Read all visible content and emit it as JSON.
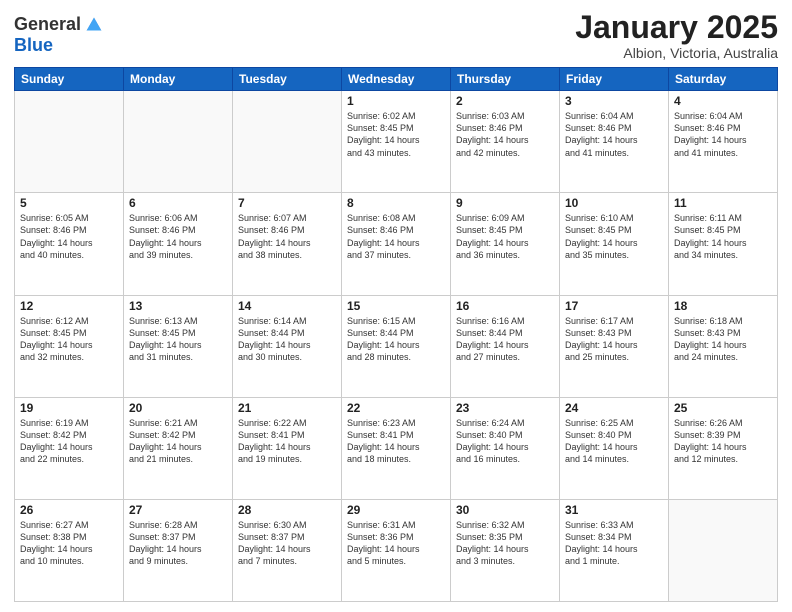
{
  "logo": {
    "general": "General",
    "blue": "Blue"
  },
  "header": {
    "month": "January 2025",
    "location": "Albion, Victoria, Australia"
  },
  "weekdays": [
    "Sunday",
    "Monday",
    "Tuesday",
    "Wednesday",
    "Thursday",
    "Friday",
    "Saturday"
  ],
  "weeks": [
    [
      {
        "day": "",
        "info": ""
      },
      {
        "day": "",
        "info": ""
      },
      {
        "day": "",
        "info": ""
      },
      {
        "day": "1",
        "info": "Sunrise: 6:02 AM\nSunset: 8:45 PM\nDaylight: 14 hours\nand 43 minutes."
      },
      {
        "day": "2",
        "info": "Sunrise: 6:03 AM\nSunset: 8:46 PM\nDaylight: 14 hours\nand 42 minutes."
      },
      {
        "day": "3",
        "info": "Sunrise: 6:04 AM\nSunset: 8:46 PM\nDaylight: 14 hours\nand 41 minutes."
      },
      {
        "day": "4",
        "info": "Sunrise: 6:04 AM\nSunset: 8:46 PM\nDaylight: 14 hours\nand 41 minutes."
      }
    ],
    [
      {
        "day": "5",
        "info": "Sunrise: 6:05 AM\nSunset: 8:46 PM\nDaylight: 14 hours\nand 40 minutes."
      },
      {
        "day": "6",
        "info": "Sunrise: 6:06 AM\nSunset: 8:46 PM\nDaylight: 14 hours\nand 39 minutes."
      },
      {
        "day": "7",
        "info": "Sunrise: 6:07 AM\nSunset: 8:46 PM\nDaylight: 14 hours\nand 38 minutes."
      },
      {
        "day": "8",
        "info": "Sunrise: 6:08 AM\nSunset: 8:46 PM\nDaylight: 14 hours\nand 37 minutes."
      },
      {
        "day": "9",
        "info": "Sunrise: 6:09 AM\nSunset: 8:45 PM\nDaylight: 14 hours\nand 36 minutes."
      },
      {
        "day": "10",
        "info": "Sunrise: 6:10 AM\nSunset: 8:45 PM\nDaylight: 14 hours\nand 35 minutes."
      },
      {
        "day": "11",
        "info": "Sunrise: 6:11 AM\nSunset: 8:45 PM\nDaylight: 14 hours\nand 34 minutes."
      }
    ],
    [
      {
        "day": "12",
        "info": "Sunrise: 6:12 AM\nSunset: 8:45 PM\nDaylight: 14 hours\nand 32 minutes."
      },
      {
        "day": "13",
        "info": "Sunrise: 6:13 AM\nSunset: 8:45 PM\nDaylight: 14 hours\nand 31 minutes."
      },
      {
        "day": "14",
        "info": "Sunrise: 6:14 AM\nSunset: 8:44 PM\nDaylight: 14 hours\nand 30 minutes."
      },
      {
        "day": "15",
        "info": "Sunrise: 6:15 AM\nSunset: 8:44 PM\nDaylight: 14 hours\nand 28 minutes."
      },
      {
        "day": "16",
        "info": "Sunrise: 6:16 AM\nSunset: 8:44 PM\nDaylight: 14 hours\nand 27 minutes."
      },
      {
        "day": "17",
        "info": "Sunrise: 6:17 AM\nSunset: 8:43 PM\nDaylight: 14 hours\nand 25 minutes."
      },
      {
        "day": "18",
        "info": "Sunrise: 6:18 AM\nSunset: 8:43 PM\nDaylight: 14 hours\nand 24 minutes."
      }
    ],
    [
      {
        "day": "19",
        "info": "Sunrise: 6:19 AM\nSunset: 8:42 PM\nDaylight: 14 hours\nand 22 minutes."
      },
      {
        "day": "20",
        "info": "Sunrise: 6:21 AM\nSunset: 8:42 PM\nDaylight: 14 hours\nand 21 minutes."
      },
      {
        "day": "21",
        "info": "Sunrise: 6:22 AM\nSunset: 8:41 PM\nDaylight: 14 hours\nand 19 minutes."
      },
      {
        "day": "22",
        "info": "Sunrise: 6:23 AM\nSunset: 8:41 PM\nDaylight: 14 hours\nand 18 minutes."
      },
      {
        "day": "23",
        "info": "Sunrise: 6:24 AM\nSunset: 8:40 PM\nDaylight: 14 hours\nand 16 minutes."
      },
      {
        "day": "24",
        "info": "Sunrise: 6:25 AM\nSunset: 8:40 PM\nDaylight: 14 hours\nand 14 minutes."
      },
      {
        "day": "25",
        "info": "Sunrise: 6:26 AM\nSunset: 8:39 PM\nDaylight: 14 hours\nand 12 minutes."
      }
    ],
    [
      {
        "day": "26",
        "info": "Sunrise: 6:27 AM\nSunset: 8:38 PM\nDaylight: 14 hours\nand 10 minutes."
      },
      {
        "day": "27",
        "info": "Sunrise: 6:28 AM\nSunset: 8:37 PM\nDaylight: 14 hours\nand 9 minutes."
      },
      {
        "day": "28",
        "info": "Sunrise: 6:30 AM\nSunset: 8:37 PM\nDaylight: 14 hours\nand 7 minutes."
      },
      {
        "day": "29",
        "info": "Sunrise: 6:31 AM\nSunset: 8:36 PM\nDaylight: 14 hours\nand 5 minutes."
      },
      {
        "day": "30",
        "info": "Sunrise: 6:32 AM\nSunset: 8:35 PM\nDaylight: 14 hours\nand 3 minutes."
      },
      {
        "day": "31",
        "info": "Sunrise: 6:33 AM\nSunset: 8:34 PM\nDaylight: 14 hours\nand 1 minute."
      },
      {
        "day": "",
        "info": ""
      }
    ]
  ]
}
